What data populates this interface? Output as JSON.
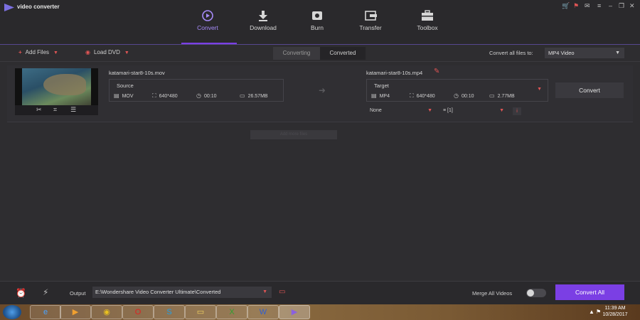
{
  "app": {
    "title": "video converter"
  },
  "window_controls": {
    "cart": "🛒",
    "gift": "⚑",
    "mail": "✉",
    "menu": "≡",
    "minimize": "–",
    "restore": "❐",
    "close": "✕"
  },
  "nav": [
    {
      "label": "Convert",
      "icon": "convert-icon",
      "active": true
    },
    {
      "label": "Download",
      "icon": "download-icon",
      "active": false
    },
    {
      "label": "Burn",
      "icon": "burn-icon",
      "active": false
    },
    {
      "label": "Transfer",
      "icon": "transfer-icon",
      "active": false
    },
    {
      "label": "Toolbox",
      "icon": "toolbox-icon",
      "active": false
    }
  ],
  "toolbar": {
    "add_files": "Add Files",
    "load_dvd": "Load DVD",
    "tab_converting": "Converting",
    "tab_converted": "Converted",
    "convert_all_to": "Convert all files to:",
    "format": "MP4 Video"
  },
  "file": {
    "source_name": "katamari-star8-10s.mov",
    "source_label": "Source",
    "source_format": "MOV",
    "source_resolution": "640*480",
    "source_duration": "00:10",
    "source_size": "26.57MB",
    "target_name": "katamari-star8-10s.mp4",
    "target_label": "Target",
    "target_format": "MP4",
    "target_resolution": "640*480",
    "target_duration": "00:10",
    "target_size": "2.77MB",
    "convert_label": "Convert",
    "subtitle": "None",
    "audio": "[1]"
  },
  "add_row_label": "Add more files",
  "bottom": {
    "output_label": "Output",
    "output_path": "E:\\Wondershare Video Converter Ultimate\\Converted",
    "merge_label": "Merge All Videos",
    "merge_on": false,
    "convert_all": "Convert All"
  },
  "taskbar": {
    "time": "11:39 AM",
    "date": "10/28/2017"
  },
  "colors": {
    "accent": "#7b3fe4",
    "red": "#e05555"
  }
}
